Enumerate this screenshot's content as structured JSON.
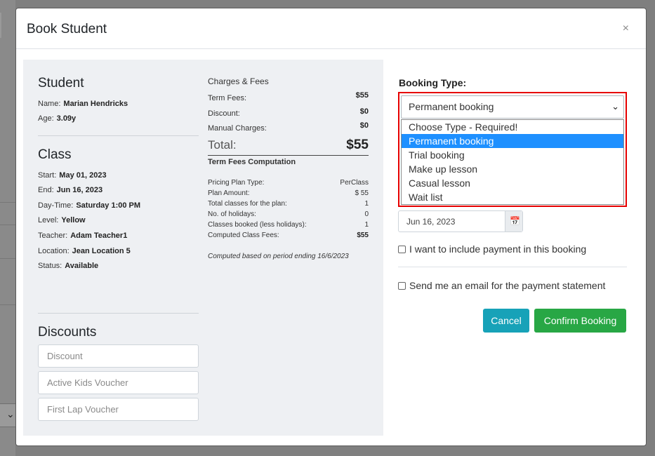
{
  "modal": {
    "title": "Book Student",
    "close_glyph": "×"
  },
  "student": {
    "heading": "Student",
    "name_label": "Name:",
    "name_value": "Marian Hendricks",
    "age_label": "Age:",
    "age_value": "3.09y"
  },
  "class": {
    "heading": "Class",
    "start_label": "Start:",
    "start_value": "May 01, 2023",
    "end_label": "End:",
    "end_value": "Jun 16, 2023",
    "daytime_label": "Day-Time:",
    "daytime_value": "Saturday 1:00 PM",
    "level_label": "Level:",
    "level_value": "Yellow",
    "teacher_label": "Teacher:",
    "teacher_value": "Adam Teacher1",
    "location_label": "Location:",
    "location_value": "Jean Location 5",
    "status_label": "Status:",
    "status_value": "Available"
  },
  "discounts": {
    "heading": "Discounts",
    "fields": [
      {
        "placeholder": "Discount"
      },
      {
        "placeholder": "Active Kids Voucher"
      },
      {
        "placeholder": "First Lap Voucher"
      }
    ]
  },
  "charges": {
    "heading": "Charges & Fees",
    "term_fees_label": "Term Fees:",
    "term_fees_value": "$55",
    "discount_label": "Discount:",
    "discount_value": "$0",
    "manual_label": "Manual Charges:",
    "manual_value": "$0",
    "total_label": "Total:",
    "total_value": "$55"
  },
  "computation": {
    "heading": "Term Fees Computation",
    "rows": [
      {
        "label": "Pricing Plan Type:",
        "value": "PerClass"
      },
      {
        "label": "Plan Amount:",
        "value": "$ 55"
      },
      {
        "label": "Total classes for the plan:",
        "value": "1"
      },
      {
        "label": "No. of holidays:",
        "value": "0"
      },
      {
        "label": "Classes booked (less holidays):",
        "value": "1"
      },
      {
        "label": "Computed Class Fees:",
        "value": "$55"
      }
    ],
    "note": "Computed based on period ending 16/6/2023"
  },
  "booking": {
    "label": "Booking Type:",
    "selected": "Permanent booking",
    "options": [
      "Choose Type - Required!",
      "Permanent booking",
      "Trial booking",
      "Make up lesson",
      "Casual lesson",
      "Wait list"
    ],
    "highlight_color": "#1e90ff",
    "outline_color": "#e60000"
  },
  "date_field": {
    "value": "Jun 16, 2023",
    "icon": "calendar-icon"
  },
  "checkboxes": {
    "include_payment": "I want to include payment in this booking",
    "email_statement": "Send me an email for the payment statement"
  },
  "buttons": {
    "cancel": "Cancel",
    "confirm": "Confirm Booking"
  },
  "colors": {
    "cancel": "#17a2b8",
    "confirm": "#28a745"
  }
}
